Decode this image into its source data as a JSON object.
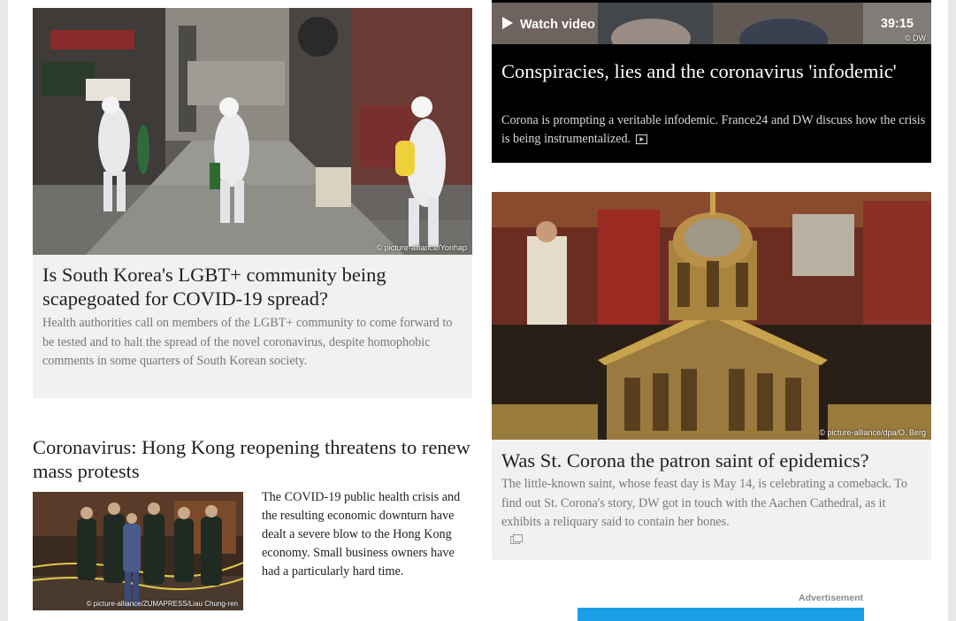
{
  "colors": {
    "page_bg": "#e9e9e9",
    "card_bg": "#f1f1f1",
    "video_card_bg": "#000000",
    "ad_bar": "#1a9fe6"
  },
  "story_korea": {
    "image_credit": "© picture-alliance/Yonhap",
    "title": "Is South Korea's LGBT+ community being scapegoated for COVID-19 spread?",
    "teaser": "Health authorities call on members of the LGBT+ community to come forward to be tested and to halt the spread of the novel coronavirus, despite homophobic comments in some quarters of South Korean society."
  },
  "story_hongkong": {
    "title": "Coronavirus: Hong Kong reopening threatens to renew mass protests",
    "image_credit": "© picture-alliance/ZUMAPRESS/Liau Chung-ren",
    "teaser": "The COVID-19 public health crisis and the resulting economic downturn have dealt a severe blow to the Hong Kong economy. Small business owners have had a particularly hard time."
  },
  "video_story": {
    "watch_label": "Watch video",
    "duration": "39:15",
    "image_credit": "© DW",
    "title": "Conspiracies, lies and the coronavirus 'infodemic'",
    "teaser": "Corona is prompting a veritable infodemic. France24 and DW discuss how the crisis is being instrumentalized.",
    "icon": "video-icon"
  },
  "story_corona": {
    "image_credit": "© picture-alliance/dpa/O. Berg",
    "title": "Was St. Corona the patron saint of epidemics?",
    "teaser": "The little-known saint, whose feast day is May 14, is celebrating a comeback. To find out St. Corona's story, DW got in touch with the Aachen Cathedral, as it exhibits a reliquary said to contain her bones.",
    "icon": "gallery-icon"
  },
  "advertisement": {
    "label": "Advertisement"
  }
}
